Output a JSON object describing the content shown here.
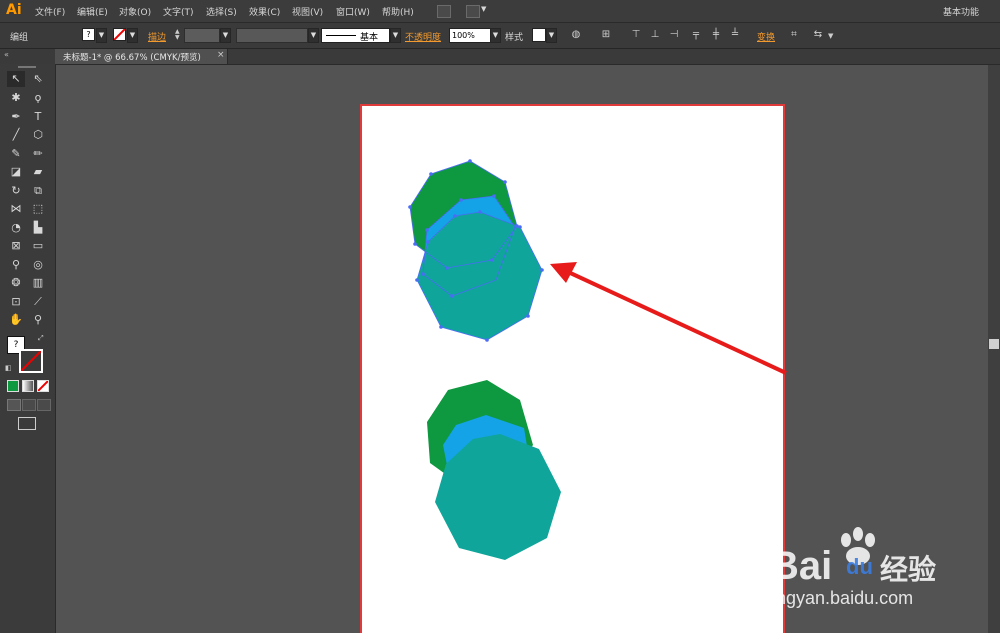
{
  "app": {
    "logo": "Ai",
    "workspace": "基本功能"
  },
  "menu": [
    "文件(F)",
    "编辑(E)",
    "对象(O)",
    "文字(T)",
    "选择(S)",
    "效果(C)",
    "视图(V)",
    "窗口(W)",
    "帮助(H)"
  ],
  "control": {
    "selection_label": "编组",
    "stroke_label": "描边",
    "stroke_profile": "基本",
    "opacity_label": "不透明度",
    "opacity_value": "100%",
    "style_label": "样式",
    "transform_label": "变换"
  },
  "document_tab": {
    "title": "未标题-1* @ 66.67% (CMYK/预览)",
    "close": "×"
  },
  "colors": {
    "green_shape": "#0e983f",
    "blue_shape": "#14a3e6",
    "teal_shape": "#0fa59a",
    "selection": "#4a6cf7",
    "arrow": "#e81b1b",
    "artboard_border": "#e03a3a"
  },
  "watermark": {
    "brand": "Bai",
    "brand2": "du",
    "suffix": "经验",
    "url": "jingyan.baidu.com"
  }
}
